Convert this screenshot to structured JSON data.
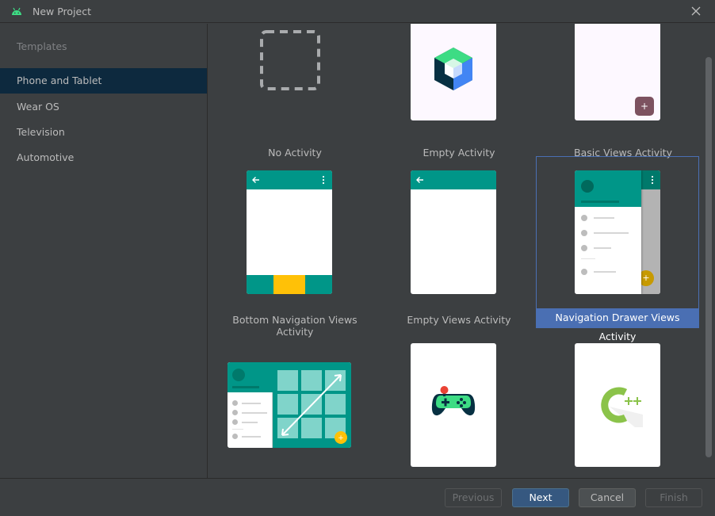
{
  "window": {
    "title": "New Project",
    "icon": "android-icon",
    "close_icon": "close-icon"
  },
  "sidebar": {
    "heading": "Templates",
    "items": [
      {
        "label": "Phone and Tablet",
        "selected": true
      },
      {
        "label": "Wear OS",
        "selected": false
      },
      {
        "label": "Television",
        "selected": false
      },
      {
        "label": "Automotive",
        "selected": false
      }
    ]
  },
  "templates": [
    {
      "label": "No Activity",
      "icon": "dashed-square-icon",
      "selected": false
    },
    {
      "label": "Empty Activity",
      "icon": "jetpack-compose-icon",
      "selected": false
    },
    {
      "label": "Basic Views Activity",
      "icon": "fab-plus-icon",
      "selected": false
    },
    {
      "label": "Bottom Navigation Views Activity",
      "icon": "bottom-navigation-icon",
      "selected": false
    },
    {
      "label": "Empty Views Activity",
      "icon": "app-bar-icon",
      "selected": false
    },
    {
      "label": "Navigation Drawer Views Activity",
      "icon": "navigation-drawer-icon",
      "selected": true
    },
    {
      "label": "",
      "icon": "responsive-layout-icon",
      "selected": false
    },
    {
      "label": "",
      "icon": "game-controller-icon",
      "selected": false
    },
    {
      "label": "",
      "icon": "cpp-icon",
      "selected": false
    }
  ],
  "footer": {
    "previous_label": "Previous",
    "next_label": "Next",
    "cancel_label": "Cancel",
    "finish_label": "Finish"
  },
  "colors": {
    "background": "#3c3f41",
    "selected_sidebar": "#0d293e",
    "selected_tile": "#4a6fb3",
    "primary_button": "#365880",
    "teal": "#009688",
    "amber": "#ffc107"
  }
}
